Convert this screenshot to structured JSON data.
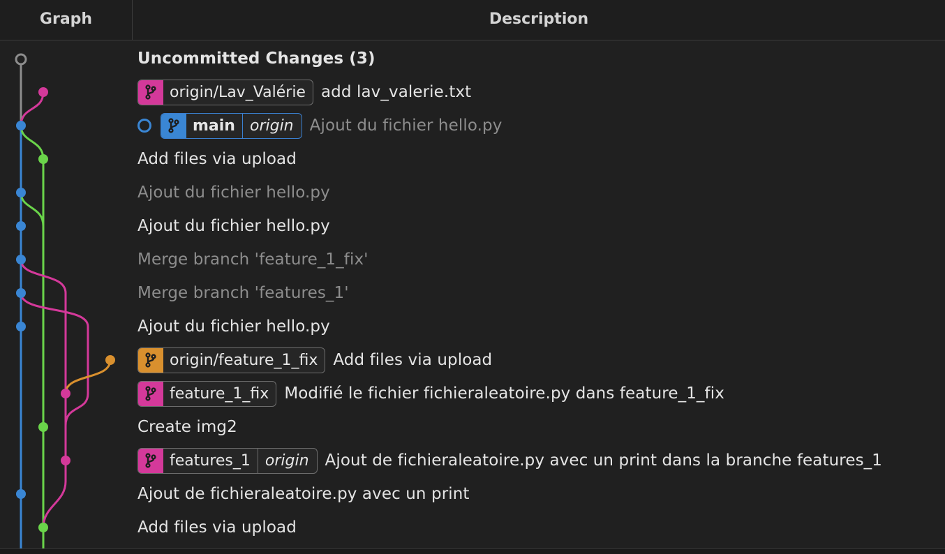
{
  "header": {
    "graph_label": "Graph",
    "description_label": "Description"
  },
  "colors": {
    "background": "#202020",
    "blue": "#3a86d4",
    "green": "#6ad44a",
    "magenta": "#d4399a",
    "orange": "#d9902e",
    "gray": "#8d8d8d"
  },
  "commits": [
    {
      "message": "Uncommitted Changes (3)",
      "style": "bold",
      "refs": []
    },
    {
      "message": "add lav_valerie.txt",
      "style": "normal",
      "refs": [
        {
          "name": "origin/Lav_Valérie",
          "remote": "",
          "color": "#d4399a",
          "icon": "branch-icon"
        }
      ]
    },
    {
      "message": "Ajout du fichier hello.py",
      "style": "dim",
      "head": true,
      "refs": [
        {
          "name": "main",
          "remote": "origin",
          "color": "#3a86d4",
          "icon": "branch-icon"
        }
      ]
    },
    {
      "message": "Add files via upload",
      "style": "normal",
      "refs": []
    },
    {
      "message": "Ajout du fichier hello.py",
      "style": "dim",
      "refs": []
    },
    {
      "message": "Ajout du fichier hello.py",
      "style": "normal",
      "refs": []
    },
    {
      "message": "Merge branch 'feature_1_fix'",
      "style": "dim",
      "refs": []
    },
    {
      "message": "Merge branch 'features_1'",
      "style": "dim",
      "refs": []
    },
    {
      "message": "Ajout du fichier hello.py",
      "style": "normal",
      "refs": []
    },
    {
      "message": "Add files via upload",
      "style": "normal",
      "refs": [
        {
          "name": "origin/feature_1_fix",
          "remote": "",
          "color": "#d9902e",
          "icon": "branch-icon"
        }
      ]
    },
    {
      "message": "Modifié le fichier fichieraleatoire.py dans feature_1_fix",
      "style": "normal",
      "refs": [
        {
          "name": "feature_1_fix",
          "remote": "",
          "color": "#d4399a",
          "icon": "branch-icon"
        }
      ]
    },
    {
      "message": "Create img2",
      "style": "normal",
      "refs": []
    },
    {
      "message": "Ajout de fichieraleatoire.py avec un print dans la branche features_1",
      "style": "normal",
      "refs": [
        {
          "name": "features_1",
          "remote": "origin",
          "color": "#d4399a",
          "icon": "branch-icon"
        }
      ]
    },
    {
      "message": "Ajout de fichieraleatoire.py avec un print",
      "style": "normal",
      "refs": []
    },
    {
      "message": "Add files via upload",
      "style": "normal",
      "refs": []
    }
  ]
}
